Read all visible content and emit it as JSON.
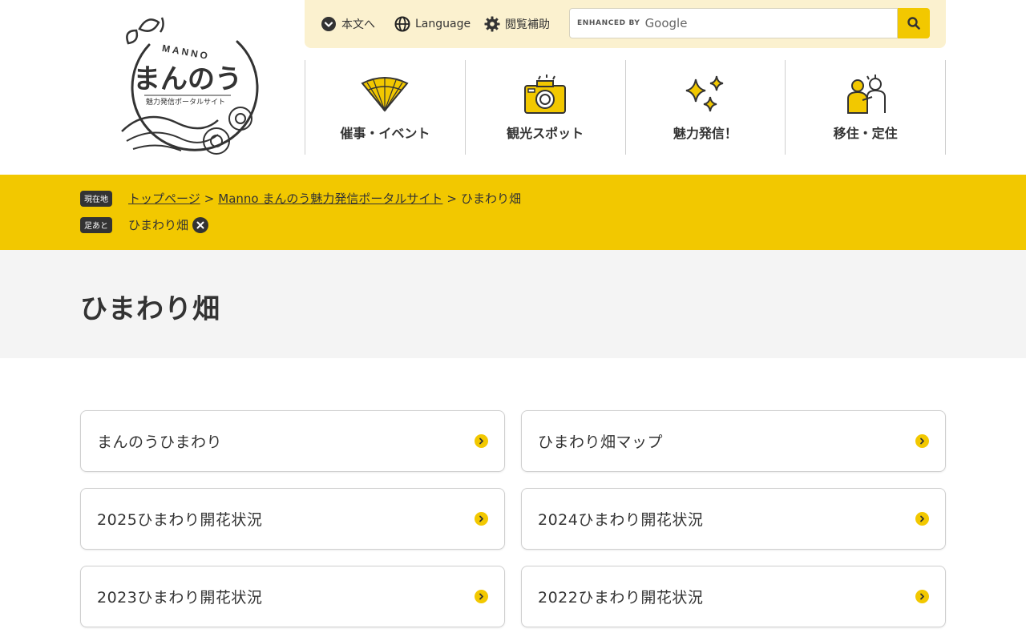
{
  "logo": {
    "brand_latin": "MANNO",
    "brand_kana": "まんのう",
    "tagline": "魅力発信ポータルサイト"
  },
  "utility": {
    "skip_label": "本文へ",
    "language_label": "Language",
    "assist_label": "閲覧補助",
    "search_enhanced": "ENHANCED BY",
    "search_google": "Google"
  },
  "gnav": [
    {
      "label": "催事・イベント",
      "icon": "folding-fan-icon"
    },
    {
      "label": "観光スポット",
      "icon": "camera-icon"
    },
    {
      "label": "魅力発信！",
      "icon": "sparkles-icon"
    },
    {
      "label": "移住・定住",
      "icon": "people-icon"
    }
  ],
  "breadcrumb": {
    "current_badge": "現在地",
    "history_badge": "足あと",
    "home": "トップページ",
    "portal": "Manno まんのう魅力発信ポータルサイト",
    "current": "ひまわり畑",
    "separator": ">",
    "history_item": "ひまわり畑"
  },
  "page_title": "ひまわり畑",
  "cards": [
    "まんのうひまわり",
    "ひまわり畑マップ",
    "2025ひまわり開花状況",
    "2024ひまわり開花状況",
    "2023ひまわり開花状況",
    "2022ひまわり開花状況"
  ],
  "colors": {
    "accent": "#f2c800",
    "utility_bg": "#fbf1cf",
    "title_bg": "#f4f4f4",
    "text": "#333333"
  }
}
